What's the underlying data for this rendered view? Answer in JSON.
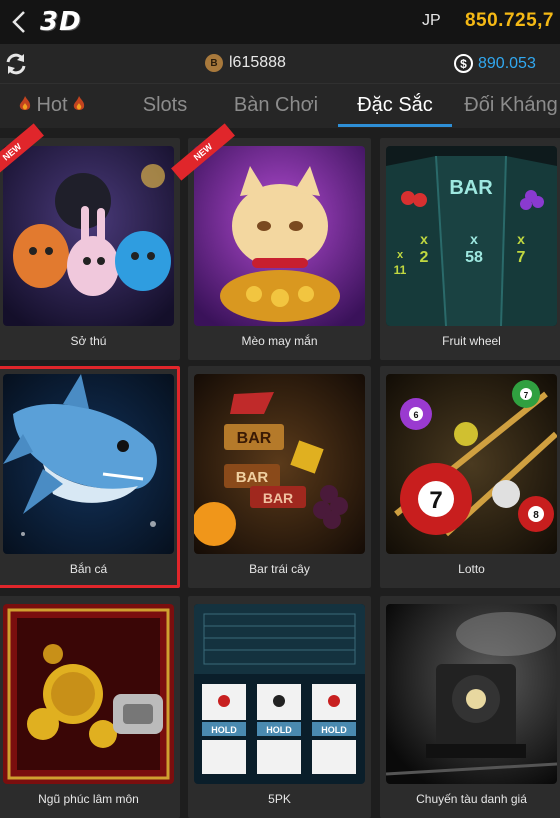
{
  "header": {
    "app_title": "3D",
    "jp_label": "JP",
    "jp_value": "850.725,7",
    "colors": {
      "jp_value": "#f5b915",
      "background": "#141414"
    }
  },
  "account": {
    "coin_letter": "B",
    "username": "l615888",
    "currency_symbol": "$",
    "balance": "890.053",
    "colors": {
      "balance": "#31a8f0"
    }
  },
  "tabs": [
    {
      "label": "Hot",
      "icon": "flame-icon",
      "active": false
    },
    {
      "label": "Slots",
      "active": false
    },
    {
      "label": "Bàn Chơi",
      "active": false
    },
    {
      "label": "Đặc Sắc",
      "active": true
    },
    {
      "label": "Đối Kháng",
      "active": false
    }
  ],
  "games": [
    {
      "label": "Sở thú",
      "badge": "NEW",
      "selected": false
    },
    {
      "label": "Mèo may mắn",
      "badge": "NEW",
      "selected": false
    },
    {
      "label": "Fruit wheel",
      "badge": "",
      "selected": false,
      "art_text": [
        "BAR",
        "x",
        "2",
        "x",
        "58",
        "x",
        "7",
        "x",
        "11"
      ]
    },
    {
      "label": "Bắn cá",
      "badge": "",
      "selected": true
    },
    {
      "label": "Bar trái cây",
      "badge": "",
      "selected": false,
      "art_text": [
        "BAR",
        "BAR",
        "BAR"
      ]
    },
    {
      "label": "Lotto",
      "badge": "",
      "selected": false,
      "art_text": [
        "7",
        "6",
        "7",
        "8"
      ]
    },
    {
      "label": "Ngũ phúc lâm môn",
      "badge": "",
      "selected": false
    },
    {
      "label": "5PK",
      "badge": "",
      "selected": false,
      "art_text": [
        "HOLD",
        "HOLD",
        "HOLD"
      ]
    },
    {
      "label": "Chuyến tàu danh giá",
      "badge": "",
      "selected": false
    }
  ],
  "accent_colors": {
    "tab_underline": "#2e8fd6",
    "selected_outline": "#e0262b"
  }
}
